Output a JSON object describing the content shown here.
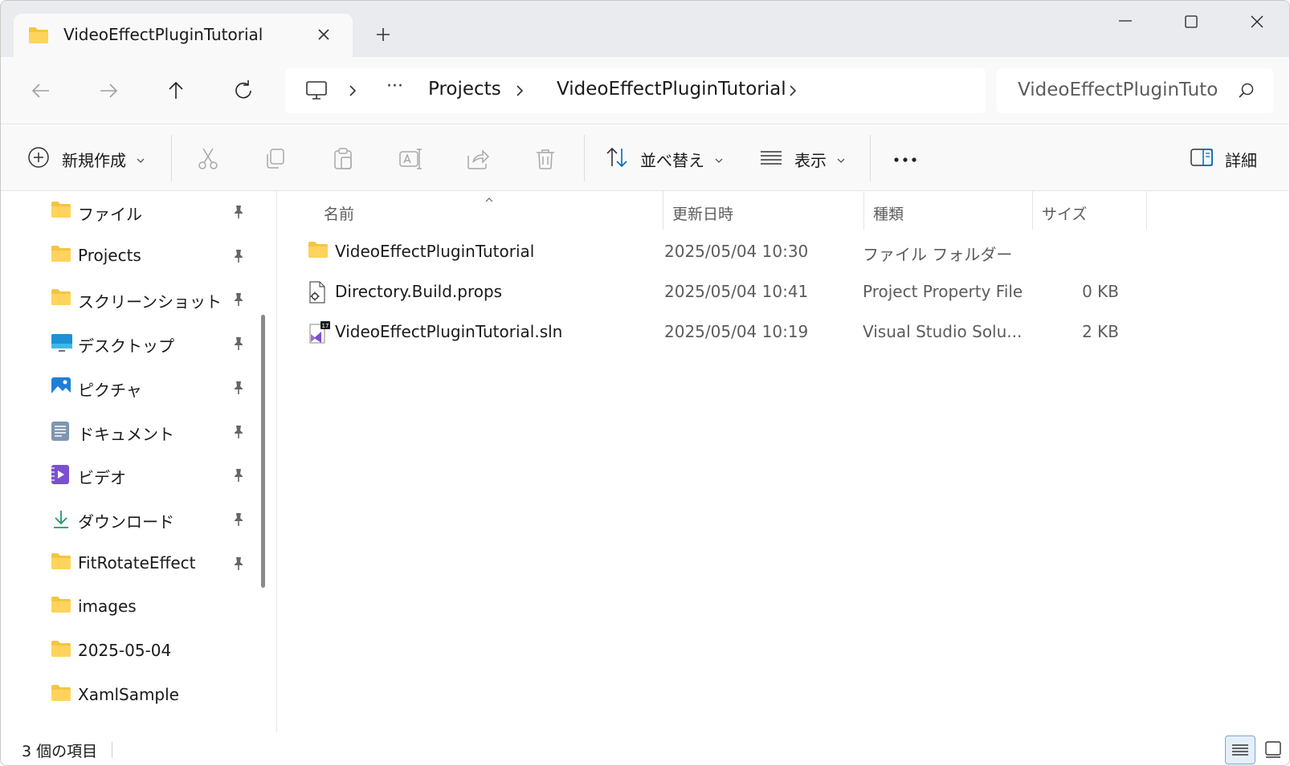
{
  "tab": {
    "title": "VideoEffectPluginTutorial"
  },
  "window_controls": {
    "minimize": "minimize",
    "maximize": "maximize",
    "close": "close"
  },
  "address": {
    "overflow": "···",
    "crumbs": [
      "Projects",
      "VideoEffectPluginTutorial"
    ]
  },
  "search": {
    "placeholder": "VideoEffectPluginTuto"
  },
  "toolbar": {
    "new_label": "新規作成",
    "sort_label": "並べ替え",
    "view_label": "表示",
    "more_label": "•••",
    "details_label": "詳細"
  },
  "sidebar": {
    "items": [
      {
        "label": "ファイル",
        "icon": "folder-icon",
        "pinned": true
      },
      {
        "label": "Projects",
        "icon": "folder-icon",
        "pinned": true
      },
      {
        "label": "スクリーンショット",
        "icon": "folder-icon",
        "pinned": true
      },
      {
        "label": "デスクトップ",
        "icon": "desktop-icon",
        "pinned": true
      },
      {
        "label": "ピクチャ",
        "icon": "pictures-icon",
        "pinned": true
      },
      {
        "label": "ドキュメント",
        "icon": "documents-icon",
        "pinned": true
      },
      {
        "label": "ビデオ",
        "icon": "videos-icon",
        "pinned": true
      },
      {
        "label": "ダウンロード",
        "icon": "download-icon",
        "pinned": true
      },
      {
        "label": "FitRotateEffect",
        "icon": "folder-icon",
        "pinned": true
      },
      {
        "label": "images",
        "icon": "folder-icon",
        "pinned": false
      },
      {
        "label": "2025-05-04",
        "icon": "folder-icon",
        "pinned": false
      },
      {
        "label": "XamlSample",
        "icon": "folder-icon",
        "pinned": false
      }
    ]
  },
  "table": {
    "columns": {
      "name": "名前",
      "date": "更新日時",
      "type": "種類",
      "size": "サイズ"
    },
    "rows": [
      {
        "name": "VideoEffectPluginTutorial",
        "date": "2025/05/04 10:30",
        "type": "ファイル フォルダー",
        "size": "",
        "icon": "folder-icon"
      },
      {
        "name": "Directory.Build.props",
        "date": "2025/05/04 10:41",
        "type": "Project Property File",
        "size": "0 KB",
        "icon": "props-file-icon"
      },
      {
        "name": "VideoEffectPluginTutorial.sln",
        "date": "2025/05/04 10:19",
        "type": "Visual Studio Solu...",
        "size": "2 KB",
        "icon": "sln-file-icon"
      }
    ]
  },
  "status": {
    "count": "3 個の項目"
  },
  "colors": {
    "folder": "#f4c542",
    "accent": "#0067c0",
    "vs_purple": "#7b4fd1"
  }
}
